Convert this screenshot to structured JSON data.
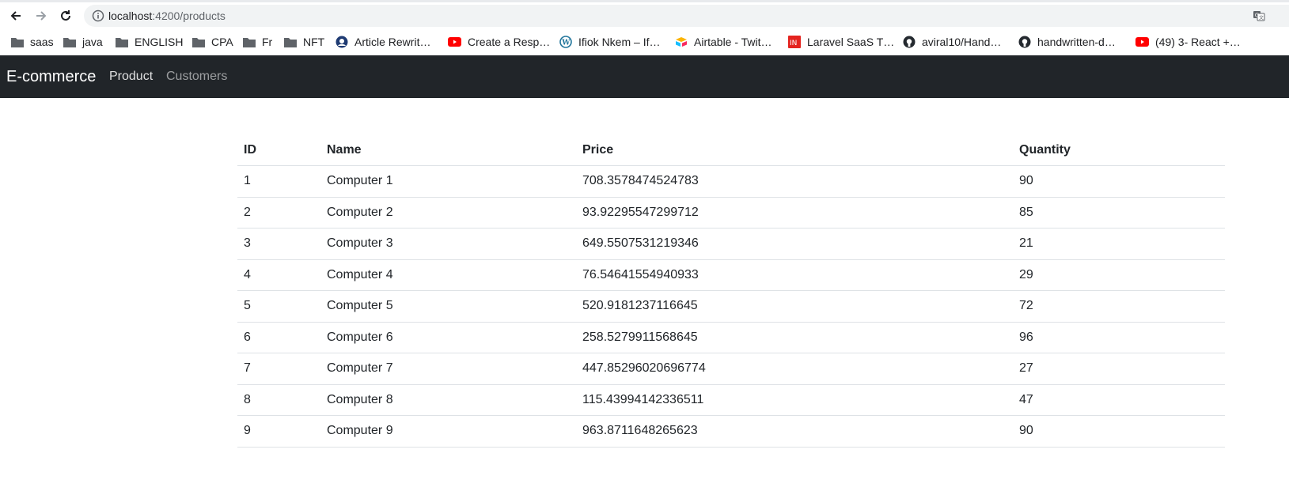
{
  "browser": {
    "url_host": "localhost",
    "url_path": ":4200/products",
    "bookmarks": [
      {
        "label": "saas",
        "icon": "folder-icon"
      },
      {
        "label": "java",
        "icon": "folder-icon"
      },
      {
        "label": "ENGLISH",
        "icon": "folder-icon"
      },
      {
        "label": "CPA",
        "icon": "folder-icon"
      },
      {
        "label": "Fr",
        "icon": "folder-icon"
      },
      {
        "label": "NFT",
        "icon": "folder-icon"
      },
      {
        "label": "Article Rewrit…",
        "icon": "site-icon"
      },
      {
        "label": "Create a Resp…",
        "icon": "youtube-icon"
      },
      {
        "label": "Ifiok Nkem – If…",
        "icon": "wordpress-icon"
      },
      {
        "label": "Airtable - Twit…",
        "icon": "airtable-icon"
      },
      {
        "label": "Laravel SaaS T…",
        "icon": "laravel-icon"
      },
      {
        "label": "aviral10/Hand…",
        "icon": "github-icon"
      },
      {
        "label": "handwritten-d…",
        "icon": "github-icon"
      },
      {
        "label": "(49) 3- React +…",
        "icon": "youtube-icon"
      }
    ]
  },
  "navbar": {
    "brand": "E-commerce",
    "links": [
      {
        "label": "Product",
        "active": true
      },
      {
        "label": "Customers",
        "active": false
      }
    ],
    "background": "#212529"
  },
  "table": {
    "headers": [
      "ID",
      "Name",
      "Price",
      "Quantity"
    ],
    "rows": [
      [
        "1",
        "Computer 1",
        "708.3578474524783",
        "90"
      ],
      [
        "2",
        "Computer 2",
        "93.92295547299712",
        "85"
      ],
      [
        "3",
        "Computer 3",
        "649.5507531219346",
        "21"
      ],
      [
        "4",
        "Computer 4",
        "76.54641554940933",
        "29"
      ],
      [
        "5",
        "Computer 5",
        "520.9181237116645",
        "72"
      ],
      [
        "6",
        "Computer 6",
        "258.5279911568645",
        "96"
      ],
      [
        "7",
        "Computer 7",
        "447.85296020696774",
        "27"
      ],
      [
        "8",
        "Computer 8",
        "115.43994142336511",
        "47"
      ],
      [
        "9",
        "Computer 9",
        "963.8711648265623",
        "90"
      ]
    ]
  }
}
